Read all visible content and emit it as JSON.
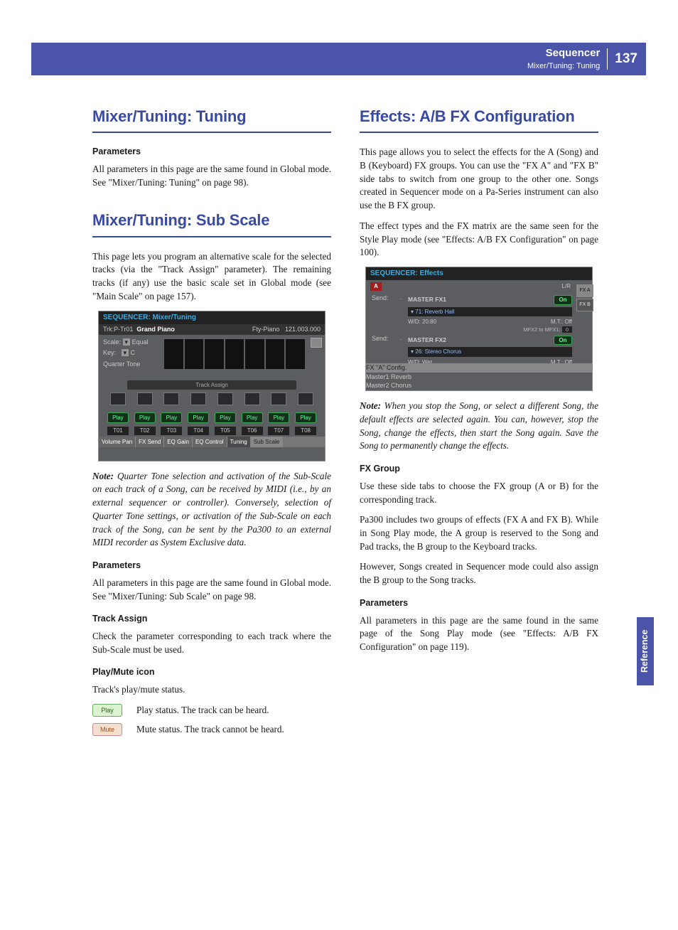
{
  "header": {
    "section": "Sequencer",
    "subtitle": "Mixer/Tuning: Tuning",
    "page_number": "137",
    "side_tab": "Reference"
  },
  "col1": {
    "h1a": "Mixer/Tuning: Tuning",
    "params_h": "Parameters",
    "params_p": "All parameters in this page are the same found in Global mode. See \"Mixer/Tuning: Tuning\" on page 98).",
    "h1b": "Mixer/Tuning: Sub Scale",
    "intro_p": "This page lets you program an alternative scale for the selected tracks (via the \"Track Assign\" parameter). The remaining tracks (if any) use the basic scale set in Global mode (see \"Main Scale\" on page 157).",
    "shot": {
      "title": "SEQUENCER: Mixer/Tuning",
      "trk_label": "Trk:P-Tr01",
      "trk_name": "Grand Piano",
      "bank": "Fty-Piano",
      "prog": "121.003.000",
      "scale_l": "Scale:",
      "scale_v": "Equal",
      "key_l": "Key:",
      "key_v": "C",
      "qt": "Quarter Tone",
      "ta_label": "Track Assign",
      "play": "Play",
      "tracks": [
        "T01",
        "T02",
        "T03",
        "T04",
        "T05",
        "T06",
        "T07",
        "T08"
      ],
      "tabs": [
        "Volume Pan",
        "FX Send",
        "EQ Gain",
        "EQ Control",
        "Tuning",
        "Sub Scale"
      ]
    },
    "note": "Quarter Tone selection and activation of the Sub-Scale on each track of a Song, can be received by MIDI (i.e., by an external sequencer or controller). Conversely, selection of Quarter Tone settings, or activation of the Sub-Scale on each track of the Song, can be sent by the Pa300 to an external MIDI recorder as System Exclusive data.",
    "note_label": "Note:",
    "params2_h": "Parameters",
    "params2_p": "All parameters in this page are the same found in Global mode. See \"Mixer/Tuning: Sub Scale\" on page 98.",
    "ta_h": "Track Assign",
    "ta_p": "Check the parameter corresponding to each track where the Sub-Scale must be used.",
    "pm_h": "Play/Mute icon",
    "pm_p": "Track's play/mute status.",
    "play_icon": "Play",
    "play_desc": "Play status. The track can be heard.",
    "mute_icon": "Mute",
    "mute_desc": "Mute status. The track cannot be heard."
  },
  "col2": {
    "h1": "Effects: A/B FX Configuration",
    "p1": "This page allows you to select the effects for the A (Song) and B (Keyboard) FX groups. You can use the \"FX A\" and \"FX B\" side tabs to switch from one group to the other one. Songs created in Sequencer mode on a Pa-Series instrument can also use the B FX group.",
    "p2": "The effect types and the FX matrix are the same seen for the Style Play mode (see \"Effects: A/B FX Configuration\" on page 100).",
    "shot": {
      "title": "SEQUENCER: Effects",
      "lr": "L/R",
      "tabA": "FX A",
      "tabB": "FX B",
      "send": "Send:",
      "fx1": "MASTER FX1",
      "fx1_preset": "71: Reverb Hall",
      "on": "On",
      "wd": "W/D:",
      "wd1": "20:80",
      "mt": "M.T.:",
      "off": "Off",
      "route": "MFX2 to MFX1:",
      "route_v": "0",
      "fx2": "MASTER FX2",
      "fx2_preset": "26: Stereo Chorus",
      "wd2": "Wet",
      "tabs": [
        "FX \"A\" Config.",
        "Master1 Reverb",
        "Master2 Chorus"
      ]
    },
    "note_label": "Note:",
    "note": "When you stop the Song, or select a different Song, the default effects are selected again. You can, however, stop the Song, change the effects, then start the Song again. Save the Song to permanently change the effects.",
    "fxg_h": "FX Group",
    "fxg_p1": "Use these side tabs to choose the FX group (A or B) for the corresponding track.",
    "fxg_p2": "Pa300 includes two groups of effects (FX A and FX B). While in Song Play mode, the A group is reserved to the Song and Pad tracks, the B group to the Keyboard tracks.",
    "fxg_p3": "However, Songs created in Sequencer mode could also assign the B group to the Song tracks.",
    "params_h": "Parameters",
    "params_p": "All parameters in this page are the same found in the same page of the Song Play mode (see \"Effects: A/B FX Configuration\" on page 119)."
  }
}
